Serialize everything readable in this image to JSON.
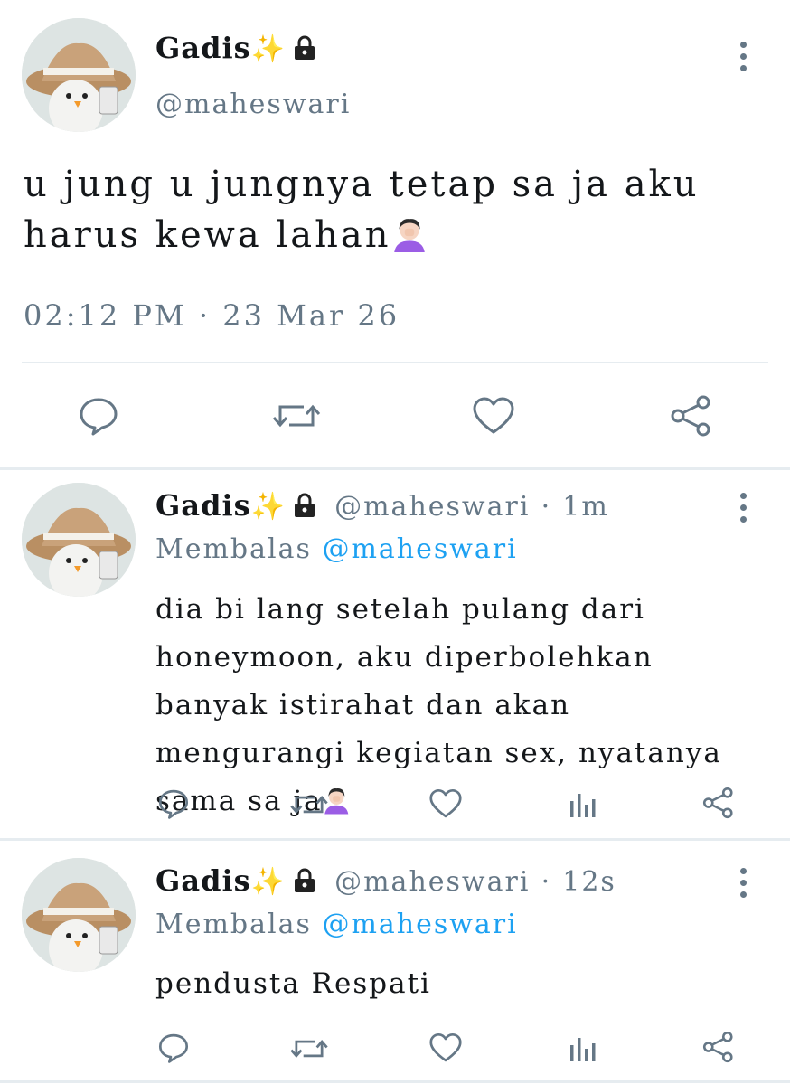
{
  "main_tweet": {
    "display_name": "Gadis",
    "name_emoji": "✨",
    "handle": "@maheswari",
    "text": "u jung u jungnya tetap sa ja aku harus kewa lahan",
    "time": "02:12 PM",
    "date": "23 Mar 26",
    "actions": [
      "reply-icon",
      "retweet-icon",
      "like-icon",
      "share-icon"
    ]
  },
  "replies": [
    {
      "display_name": "Gadis",
      "name_emoji": "✨",
      "handle": "@maheswari",
      "age": "1m",
      "reply_prefix": "Membalas",
      "reply_to": "@maheswari",
      "text": "dia bi lang setelah pulang dari honeymoon, aku diperbolehkan banyak istirahat dan akan mengurangi kegiatan sex, nyatanya sama sa ja"
    },
    {
      "display_name": "Gadis",
      "name_emoji": "✨",
      "handle": "@maheswari",
      "age": "12s",
      "reply_prefix": "Membalas",
      "reply_to": "@maheswari",
      "text": "pendusta Respati"
    }
  ],
  "separator_dot": "·",
  "colors": {
    "text": "#14171a",
    "secondary": "#657786",
    "mention": "#1da1f2",
    "divider": "#e6ecf0"
  }
}
